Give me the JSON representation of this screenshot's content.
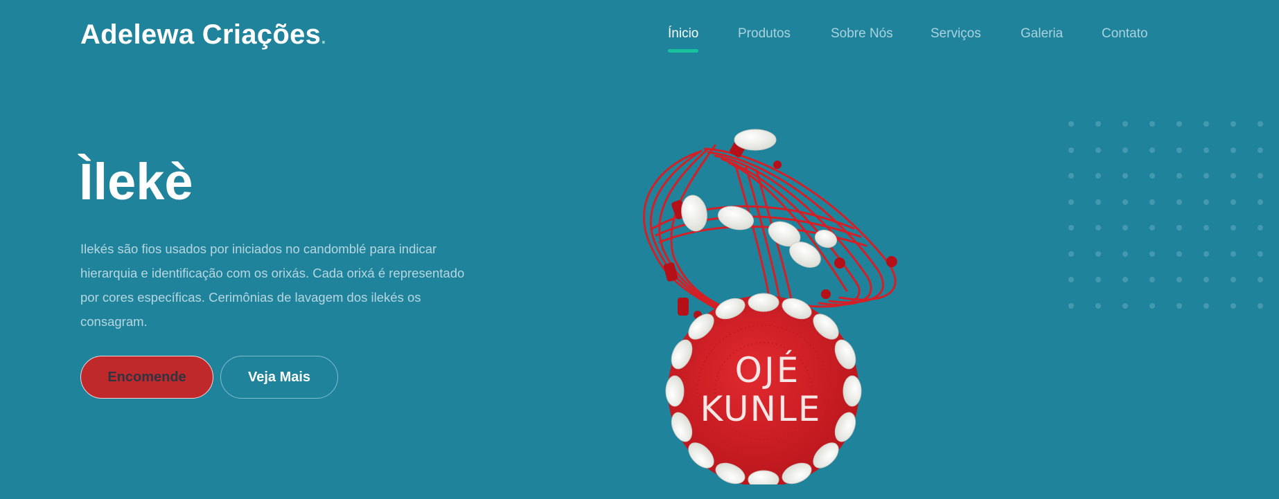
{
  "brand": {
    "name": "Adelewa Criações",
    "dot": "."
  },
  "nav": {
    "items": [
      {
        "label": "Ínicio",
        "active": true
      },
      {
        "label": "Produtos",
        "active": false
      },
      {
        "label": "Sobre Nós",
        "active": false
      },
      {
        "label": "Serviços",
        "active": false
      },
      {
        "label": "Galeria",
        "active": false
      },
      {
        "label": "Contato",
        "active": false
      }
    ]
  },
  "hero": {
    "title": "Ìlekè",
    "description": "Ilekés são fios usados por iniciados no candomblé para indicar hierarquia e identificação com os orixás. Cada orixá é representado por cores específicas. Cerimônias de lavagem dos ilekés os consagram.",
    "primary_button": "Encomende",
    "secondary_button": "Veja Mais"
  },
  "product_image": {
    "inscription_line1": "OJÉ",
    "inscription_line2": "KUNLE"
  },
  "colors": {
    "background": "#1f839c",
    "accent": "#18c29c",
    "button_red": "#c0292b",
    "bead_red": "#d41f26",
    "shell_white": "#f5f5f2"
  }
}
